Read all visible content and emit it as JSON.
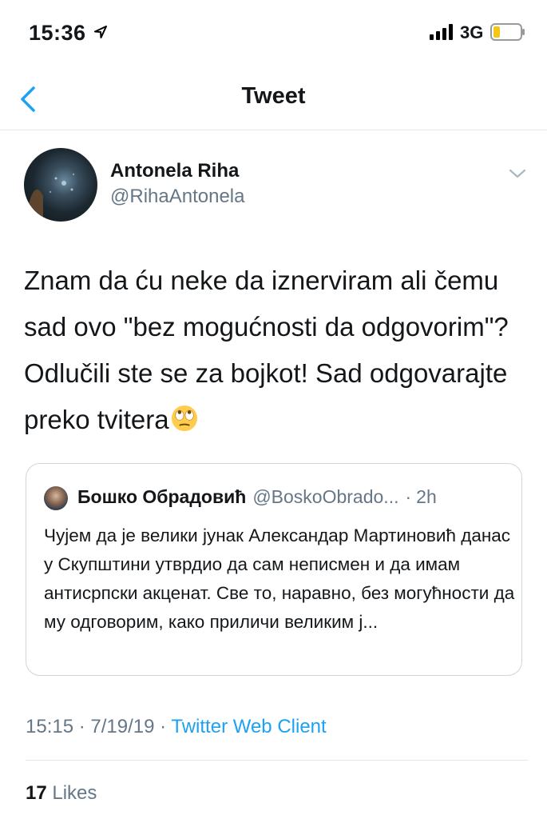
{
  "status_bar": {
    "time": "15:36",
    "network": "3G",
    "icons": [
      "location-arrow-icon",
      "signal-bars-icon",
      "battery-low-icon"
    ]
  },
  "nav": {
    "back_icon": "chevron-left-icon",
    "title": "Tweet"
  },
  "tweet": {
    "author_name": "Antonela Riha",
    "author_handle": "@RihaAntonela",
    "more_icon": "chevron-down-icon",
    "text": "Znam da ću neke da iznerviram ali čemu sad ovo \"bez mogućnosti da odgovorim\"? Odlučili ste se za bojkot! Sad odgovarajte preko tvitera",
    "emoji": "face-with-rolling-eyes-emoji",
    "time": "15:15",
    "date": "7/19/19",
    "client": "Twitter Web Client",
    "likes_count": "17",
    "likes_label": "Likes"
  },
  "quoted_tweet": {
    "author_name": "Бошко Обрадовић",
    "author_handle": "@BoskoObrado...",
    "age": "2h",
    "text": "Чујем да је велики јунак Александар Мартиновић данас у Скупштини утврдио да сам неписмен и да имам антисрпски акценат. Све то, наравно, без могућности да му одговорим, како приличи великим ј..."
  },
  "colors": {
    "accent": "#1da1f2",
    "text": "#14171a",
    "secondary_text": "#657786",
    "divider": "#e1e8ed",
    "battery_low": "#f5c518"
  }
}
